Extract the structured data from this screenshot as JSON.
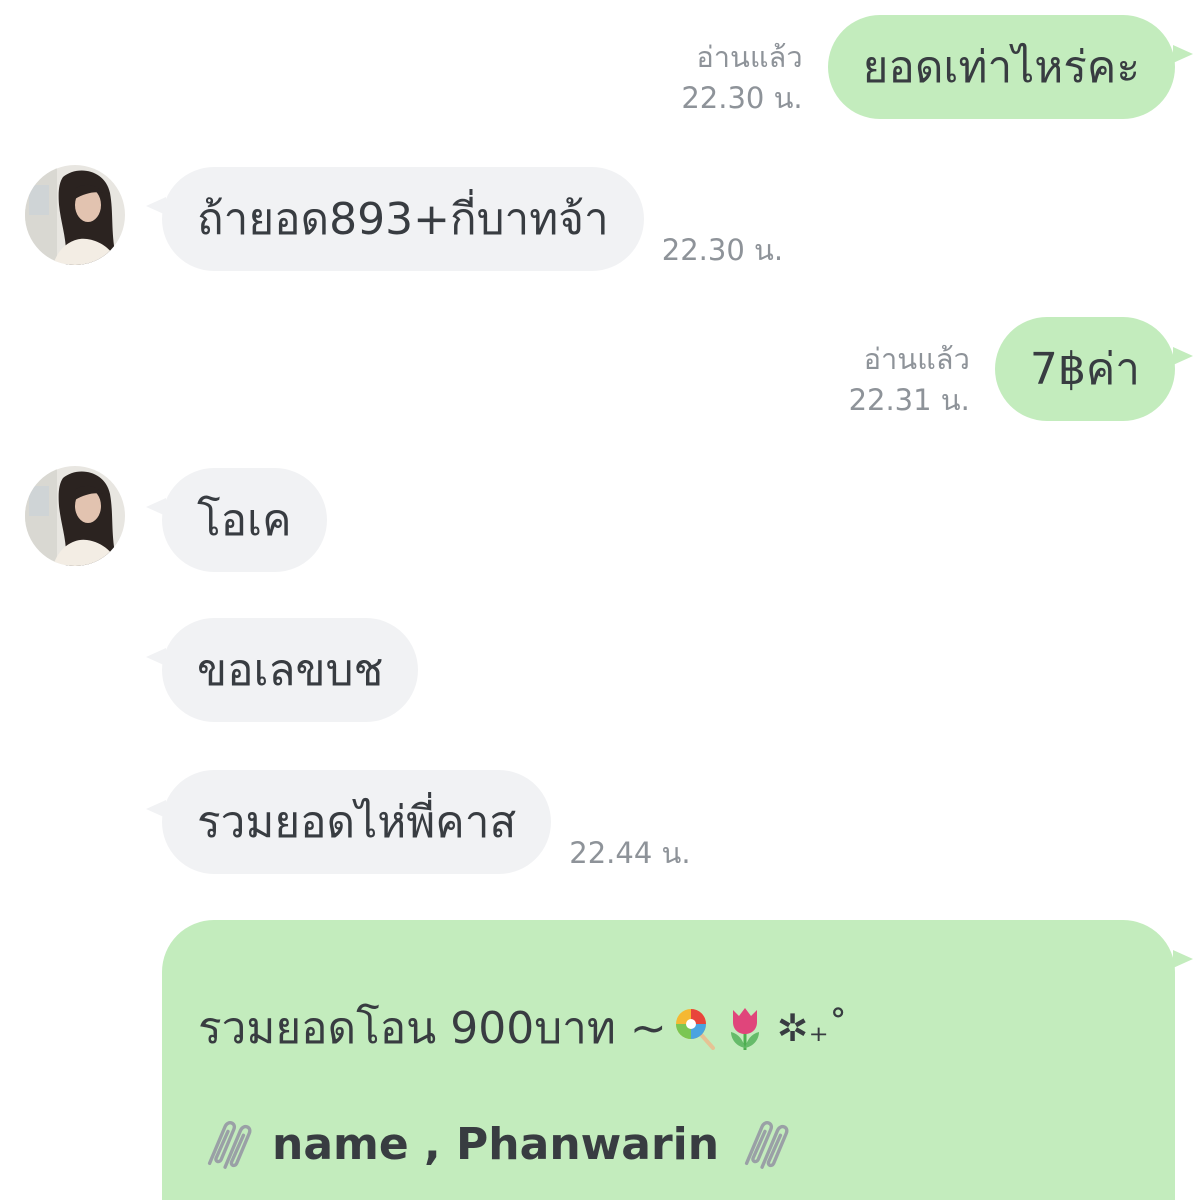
{
  "chat": {
    "messages": [
      {
        "direction": "outgoing",
        "text": "ยอดเท่าไหร่คะ",
        "read_label": "อ่านแล้ว",
        "time": "22.30 น."
      },
      {
        "direction": "incoming",
        "text": "ถ้ายอด893+กี่บาทจ้า",
        "time": "22.30 น."
      },
      {
        "direction": "outgoing",
        "text": "7฿ค่า",
        "read_label": "อ่านแล้ว",
        "time": "22.31 น."
      },
      {
        "direction": "incoming",
        "text": "โอเค"
      },
      {
        "direction": "incoming",
        "text": "ขอเลขบช"
      },
      {
        "direction": "incoming",
        "text": "รวมยอดไห่พี่คาส",
        "time": "22.44 น."
      },
      {
        "direction": "outgoing",
        "line1_text": "รวมยอดโอน 900บาท ~",
        "line1_icons": [
          "lollipop-icon",
          "tulip-icon"
        ],
        "line1_suffix": "✲₊˚",
        "line2_text": "name , Phanwarin",
        "line2_icons": [
          "paperclip-icon",
          "paperclip-icon"
        ]
      }
    ]
  },
  "colors": {
    "outgoing_bubble": "#c3ecbd",
    "incoming_bubble": "#f1f2f4",
    "message_text": "#383c41",
    "meta_text": "#8e9399",
    "background": "#ffffff"
  }
}
